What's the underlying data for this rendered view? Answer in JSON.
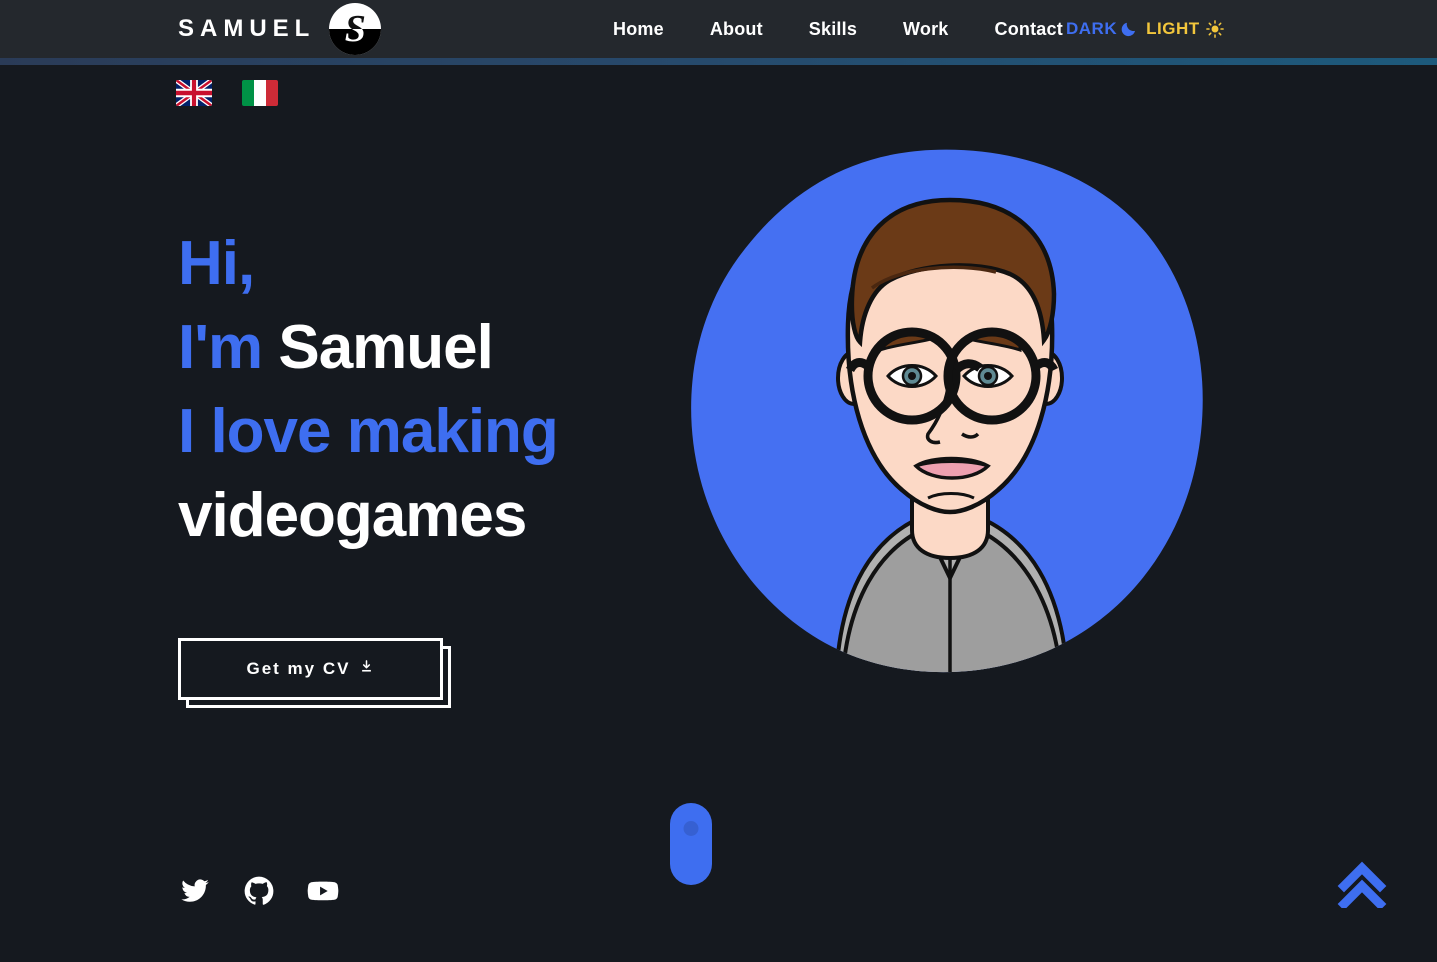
{
  "header": {
    "brand_name": "SAMUEL",
    "logo_letter": "S",
    "nav": [
      {
        "label": "Home"
      },
      {
        "label": "About"
      },
      {
        "label": "Skills"
      },
      {
        "label": "Work"
      },
      {
        "label": "Contact"
      }
    ],
    "theme_toggle": {
      "dark_label": "DARK",
      "light_label": "LIGHT",
      "moon_icon": "moon-icon",
      "sun_icon": "sun-icon",
      "dark_color": "#3e6ef0",
      "light_color": "#f2c63c"
    }
  },
  "language_switch": {
    "options": [
      {
        "name": "english",
        "icon": "uk-flag-icon"
      },
      {
        "name": "italian",
        "icon": "italy-flag-icon"
      }
    ]
  },
  "hero": {
    "line1": "Hi,",
    "line2_accent": "I'm",
    "line2_plain": "Samuel",
    "line3": "I love making",
    "line4": "videogames",
    "cv_button_label": "Get my CV",
    "cv_button_icon": "download-icon",
    "avatar_alt": "samuel-avatar-illustration"
  },
  "scroll_indicator": {
    "name": "scroll-mouse-indicator"
  },
  "social": [
    {
      "name": "twitter",
      "icon": "twitter-icon"
    },
    {
      "name": "github",
      "icon": "github-icon"
    },
    {
      "name": "youtube",
      "icon": "youtube-icon"
    }
  ],
  "back_to_top": {
    "icon": "double-chevron-up-icon"
  },
  "theme": {
    "background": "#15191f",
    "header_background": "#24282d",
    "accent_blue": "#3e6ef0",
    "accent_yellow": "#f2c63c",
    "text_white": "#ffffff",
    "progress_gradient_start": "#2a3b57",
    "progress_gradient_end": "#1d5a7c"
  }
}
